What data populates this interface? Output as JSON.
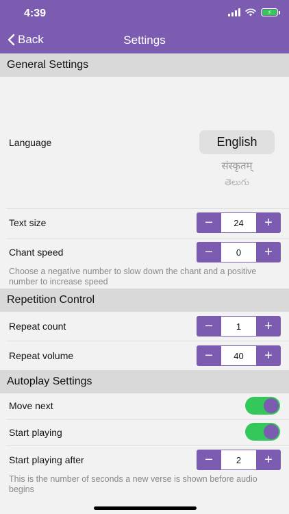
{
  "status": {
    "time": "4:39"
  },
  "nav": {
    "back_label": "Back",
    "title": "Settings"
  },
  "sections": {
    "general": "General Settings",
    "repetition": "Repetition Control",
    "autoplay": "Autoplay Settings"
  },
  "language": {
    "label": "Language",
    "selected": "English",
    "options": [
      "संस्कृतम्",
      "తెలుగు"
    ]
  },
  "text_size": {
    "label": "Text size",
    "value": "24"
  },
  "chant_speed": {
    "label": "Chant speed",
    "value": "0",
    "hint": "Choose a negative number to slow down the chant and a positive number to increase speed"
  },
  "repeat_count": {
    "label": "Repeat count",
    "value": "1"
  },
  "repeat_volume": {
    "label": "Repeat volume",
    "value": "40"
  },
  "move_next": {
    "label": "Move next",
    "on": true
  },
  "start_playing": {
    "label": "Start playing",
    "on": true
  },
  "start_after": {
    "label": "Start playing after",
    "value": "2",
    "hint": "This is the number of seconds a new verse is shown before audio begins"
  },
  "stepper": {
    "minus": "−",
    "plus": "+"
  },
  "colors": {
    "accent": "#7b5cb1",
    "toggle_on": "#34c759",
    "section_bg": "#d9d9d9"
  }
}
